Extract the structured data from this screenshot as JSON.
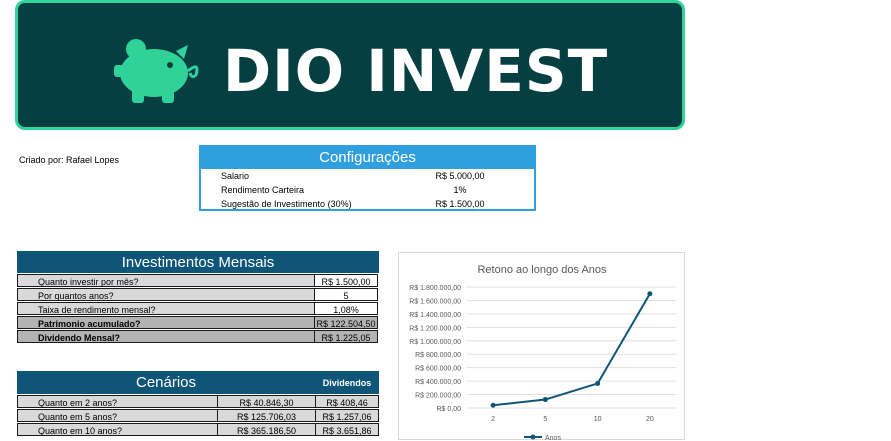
{
  "banner": {
    "title": "DIO INVEST",
    "accent": "#2fd39a",
    "background": "#063f42",
    "icon": "piggy-bank-icon"
  },
  "creator": "Criado por: Rafael Lopes",
  "config": {
    "title": "Configurações",
    "rows": [
      {
        "label": "Salario",
        "value": "R$ 5.000,00"
      },
      {
        "label": "Rendimento Carteira",
        "value": "1%"
      },
      {
        "label": "Sugestão de Investimento (30%)",
        "value": "R$ 1.500,00"
      }
    ]
  },
  "investimentos": {
    "title": "Investimentos Mensais",
    "rows": [
      {
        "label": "Quanto investir por mês?",
        "value": "R$ 1.500,00"
      },
      {
        "label": "Por quantos anos?",
        "value": "5"
      },
      {
        "label": "Taixa de rendimento mensal?",
        "value": "1,08%"
      },
      {
        "label": "Patrimonio acumulado?",
        "value": "R$ 122.504,50"
      },
      {
        "label": "Dividendo Mensal?",
        "value": "R$ 1.225,05"
      }
    ]
  },
  "cenarios": {
    "title": "Cenários",
    "dividends_header": "Dividendos",
    "rows": [
      {
        "label": "Quanto em 2 anos?",
        "value": "R$ 40.846,30",
        "dividend": "R$ 408,46"
      },
      {
        "label": "Quanto em 5 anos?",
        "value": "R$ 125.706,03",
        "dividend": "R$ 1.257,06"
      },
      {
        "label": "Quanto em 10 anos?",
        "value": "R$ 365.186,50",
        "dividend": "R$ 3.651,86"
      }
    ]
  },
  "chart_data": {
    "type": "line",
    "title": "Retono ao longo dos Anos",
    "categories": [
      "2",
      "5",
      "10",
      "20"
    ],
    "series": [
      {
        "name": "Anos",
        "values": [
          40846.3,
          125706.03,
          365186.5,
          1700000
        ],
        "color": "#0e5578"
      }
    ],
    "y_ticks": [
      "R$ 0,00",
      "R$ 200.000,00",
      "R$ 400.000,00",
      "R$ 600.000,00",
      "R$ 800.000,00",
      "R$ 1.000.000,00",
      "R$ 1.200.000,00",
      "R$ 1.400.000,00",
      "R$ 1.600.000,00",
      "R$ 1.800.000,00"
    ],
    "ylim": [
      0,
      1800000
    ],
    "grid": true,
    "legend": "bottom"
  }
}
